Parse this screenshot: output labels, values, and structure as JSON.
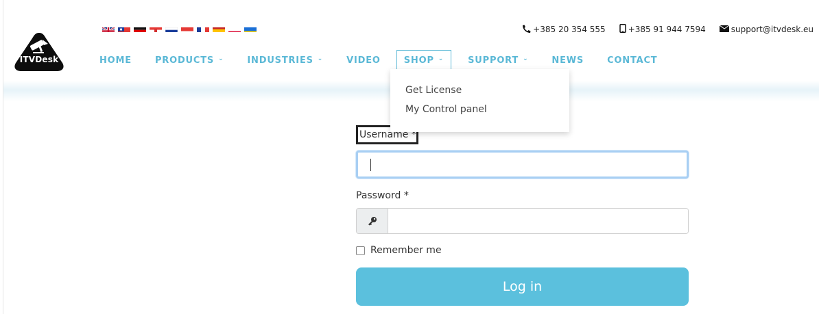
{
  "brand": {
    "logo_text": "ITVDesk"
  },
  "flags": [
    {
      "name": "uk-flag"
    },
    {
      "name": "taiwan-flag"
    },
    {
      "name": "germany-flag"
    },
    {
      "name": "croatia-flag"
    },
    {
      "name": "russia-flag"
    },
    {
      "name": "indonesia-flag"
    },
    {
      "name": "france-flag"
    },
    {
      "name": "spain-flag"
    },
    {
      "name": "poland-flag"
    },
    {
      "name": "ukraine-flag"
    }
  ],
  "contact": {
    "phone": "+385 20 354 555",
    "mobile": "+385 91 944 7594",
    "email": "support@itvdesk.eu"
  },
  "nav": {
    "home": "HOME",
    "products": "PRODUCTS",
    "industries": "INDUSTRIES",
    "video": "VIDEO",
    "shop": "SHOP",
    "support": "SUPPORT",
    "news": "NEWS",
    "contact": "CONTACT"
  },
  "shop_menu": {
    "items": [
      "Get License",
      "My Control panel"
    ]
  },
  "form": {
    "username_label": "Username *",
    "username_value": "",
    "password_label": "Password *",
    "password_value": "",
    "remember_label": "Remember me",
    "remember_checked": false,
    "login_label": "Log in"
  },
  "colors": {
    "accent": "#5ab8d6",
    "button": "#5bc0dd"
  }
}
